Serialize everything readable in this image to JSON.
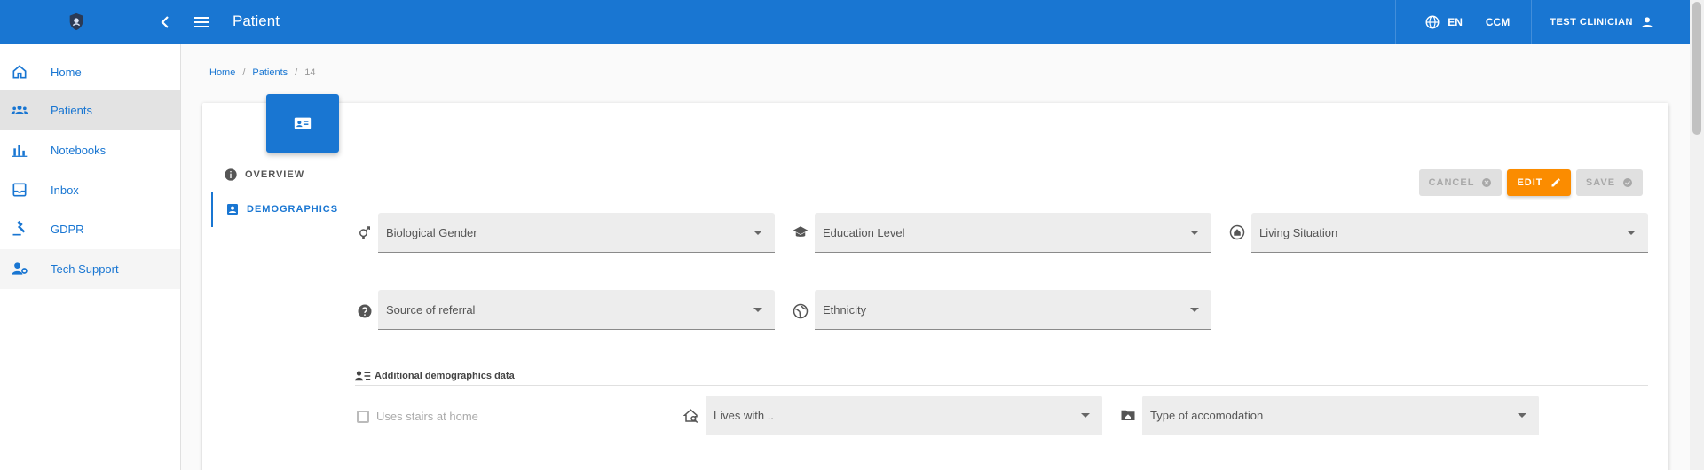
{
  "app": {
    "page_title": "Patient",
    "language": "EN",
    "ccm_label": "CCM",
    "user_name": "TEST CLINICIAN"
  },
  "sidebar": {
    "items": [
      {
        "label": "Home",
        "icon": "home-icon",
        "state": "default"
      },
      {
        "label": "Patients",
        "icon": "people-icon",
        "state": "active"
      },
      {
        "label": "Notebooks",
        "icon": "bar-chart-icon",
        "state": "default"
      },
      {
        "label": "Inbox",
        "icon": "inbox-icon",
        "state": "default"
      },
      {
        "label": "GDPR",
        "icon": "gavel-icon",
        "state": "default"
      },
      {
        "label": "Tech Support",
        "icon": "support-agent-icon",
        "state": "default"
      }
    ]
  },
  "breadcrumb": {
    "home": "Home",
    "patients": "Patients",
    "current": "14"
  },
  "tabs": {
    "overview": "OVERVIEW",
    "demographics": "DEMOGRAPHICS"
  },
  "actions": {
    "cancel": "CANCEL",
    "edit": "EDIT",
    "save": "SAVE"
  },
  "fields": {
    "biological_gender": "Biological Gender",
    "education_level": "Education Level",
    "living_situation": "Living Situation",
    "source_of_referral": "Source of referral",
    "ethnicity": "Ethnicity",
    "lives_with": "Lives with ..",
    "type_of_accomodation": "Type of accomodation"
  },
  "additional": {
    "title": "Additional demographics data",
    "stairs_label": "Uses stairs at home",
    "stairs_checked": false
  },
  "colors": {
    "primary": "#1976d2",
    "accent": "#fb8c00"
  }
}
